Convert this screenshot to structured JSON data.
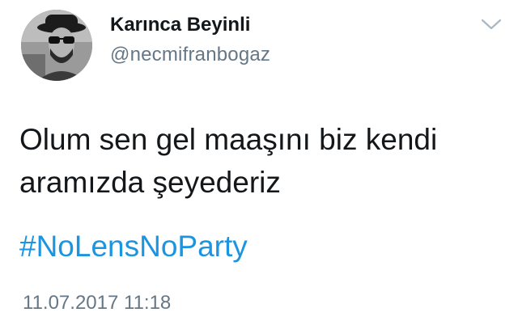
{
  "tweet": {
    "author": {
      "display_name": "Karınca Beyinli",
      "handle": "@necmifranbogaz",
      "avatar_icon": "avatar-photo"
    },
    "menu_icon": "chevron-down-icon",
    "text_lines": [
      "Olum sen gel maaşını biz kendi",
      "aramızda şeyederiz"
    ],
    "hashtag": "#NoLensNoParty",
    "timestamp": "11.07.2017 11:18"
  },
  "colors": {
    "text_primary": "#14171a",
    "text_secondary": "#657786",
    "link": "#1b95e0",
    "background": "#ffffff"
  }
}
